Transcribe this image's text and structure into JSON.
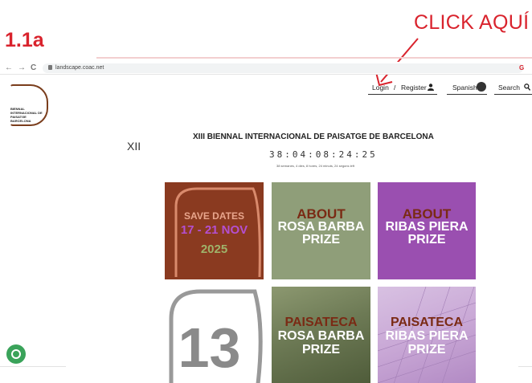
{
  "annotation": {
    "step_label": "1.1a",
    "click_label": "CLICK AQUÍ"
  },
  "browser": {
    "back": "←",
    "forward": "→",
    "reload": "C",
    "url": "landscape.coac.net",
    "g_icon": "G"
  },
  "nav": {
    "login": "Login",
    "separator": "/",
    "register": "Register",
    "language": "Spanish",
    "search": "Search"
  },
  "logo": {
    "text": "BIENNAL INTERNACIONAL DE PAISATGE BARCELONA"
  },
  "side_label": "XII",
  "title": "XIII BIENNAL INTERNACIONAL DE PAISATGE DE BARCELONA",
  "countdown": {
    "value": "38:04:08:24:25",
    "units": "38 semanes, 4 dies, 8 hores, 24 minuts, 24 segons left"
  },
  "tiles": [
    {
      "lines": [
        "SAVE DATES",
        "17 - 21 NOV",
        "2025"
      ],
      "bg": "#8a3a20"
    },
    {
      "lines": [
        "ABOUT",
        "ROSA BARBA",
        "PRIZE"
      ],
      "bg": "#8f9e79"
    },
    {
      "lines": [
        "ABOUT",
        "RIBAS PIERA",
        "PRIZE"
      ],
      "bg": "#9a4fb0"
    },
    {
      "lines": [
        "13"
      ],
      "bg": "#ffffff"
    },
    {
      "lines": [
        "PAISATECA",
        "ROSA BARBA",
        "PRIZE"
      ],
      "bg": "#6d7a55"
    },
    {
      "lines": [
        "PAISATECA",
        "RIBAS PIERA",
        "PRIZE"
      ],
      "bg": "#c9a8d6"
    }
  ],
  "colors": {
    "accent_red": "#d9232d",
    "brown": "#7a3d1c",
    "cookie_green": "#3aa35a"
  },
  "icons": {
    "user": "user-icon",
    "globe": "globe-icon",
    "search": "search-icon",
    "cookie": "cookie-icon"
  }
}
